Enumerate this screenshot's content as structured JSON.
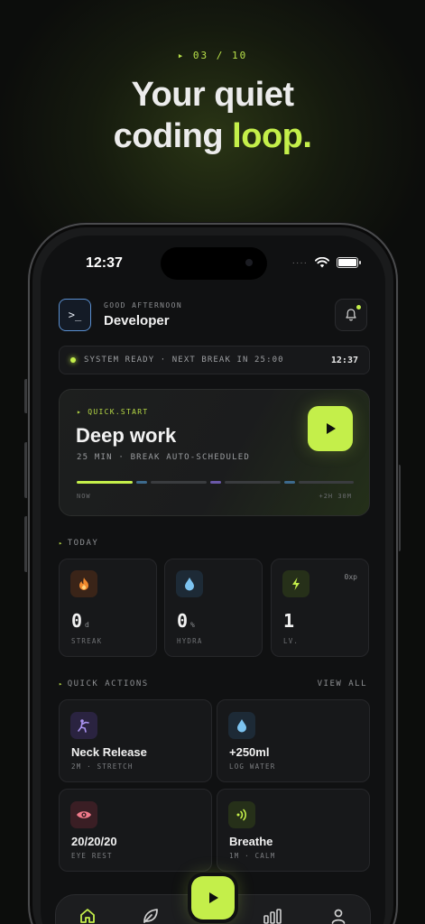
{
  "promo": {
    "step": "▸ 03 / 10",
    "headline_line1": "Your quiet",
    "headline_line2_prefix": "coding ",
    "headline_line2_accent": "loop."
  },
  "status_bar": {
    "time": "12:37",
    "signal": "····"
  },
  "header": {
    "avatar_glyph": ">_",
    "greeting": "GOOD AFTERNOON",
    "name": "Developer"
  },
  "system_bar": {
    "text": "SYSTEM READY · NEXT BREAK IN 25:00",
    "time": "12:37"
  },
  "quick_start": {
    "label": "▸ QUICK.START",
    "title": "Deep work",
    "subtitle": "25 MIN · BREAK AUTO-SCHEDULED",
    "timeline_start": "NOW",
    "timeline_end": "+2H 30M"
  },
  "today": {
    "label": "TODAY",
    "stats": [
      {
        "value": "0",
        "unit": "d",
        "label": "STREAK",
        "icon": "flame-icon"
      },
      {
        "value": "0",
        "unit": "%",
        "label": "HYDRA",
        "icon": "water-drop-icon"
      },
      {
        "value": "1",
        "unit": "",
        "label": "LV.",
        "icon": "bolt-icon",
        "xp": "0xp"
      }
    ]
  },
  "quick_actions": {
    "label": "QUICK ACTIONS",
    "view_all": "VIEW ALL",
    "items": [
      {
        "title": "Neck Release",
        "sub": "2M · STRETCH",
        "icon": "stretch-figure-icon"
      },
      {
        "title": "+250ml",
        "sub": "LOG WATER",
        "icon": "water-drop-icon"
      },
      {
        "title": "20/20/20",
        "sub": "EYE REST",
        "icon": "eye-icon"
      },
      {
        "title": "Breathe",
        "sub": "1M · CALM",
        "icon": "sound-waves-icon"
      }
    ]
  },
  "nav": {
    "items": [
      "home-icon",
      "leaf-icon",
      "play-icon",
      "stats-bars-icon",
      "profile-icon"
    ]
  },
  "colors": {
    "accent": "#c4ef4a",
    "background": "#101112",
    "card": "#17181a",
    "timeline_blue": "#3d6a8c",
    "timeline_purple": "#6a58a8"
  }
}
